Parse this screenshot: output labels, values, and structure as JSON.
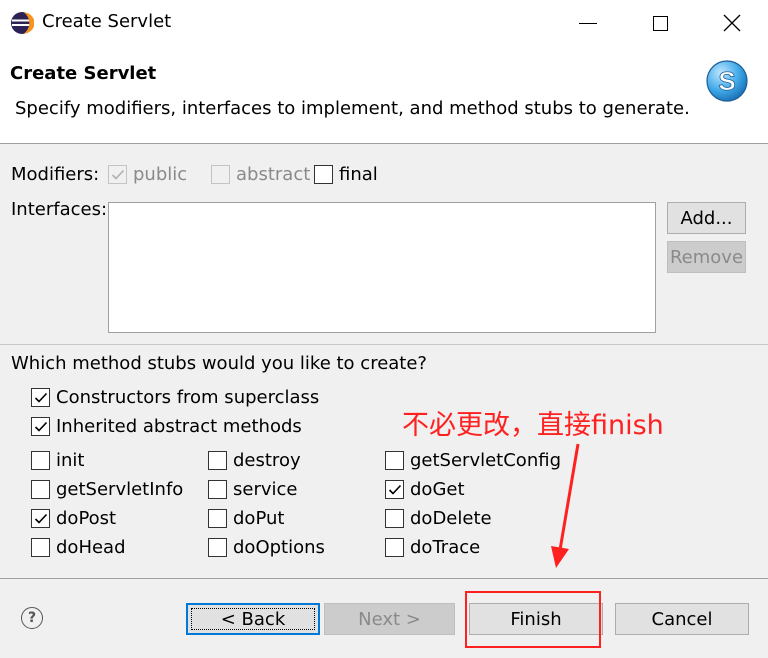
{
  "window": {
    "title": "Create Servlet"
  },
  "header": {
    "title": "Create Servlet",
    "description": "Specify modifiers, interfaces to implement, and method stubs to generate."
  },
  "modifiers": {
    "label": "Modifiers:",
    "public": {
      "label": "public",
      "checked": true,
      "enabled": false
    },
    "abstract": {
      "label": "abstract",
      "checked": false,
      "enabled": false
    },
    "final": {
      "label": "final",
      "checked": false,
      "enabled": true
    }
  },
  "interfaces": {
    "label": "Interfaces:",
    "add_label": "Add...",
    "remove_label": "Remove"
  },
  "stubs": {
    "question": "Which method stubs would you like to create?",
    "constructors": {
      "label": "Constructors from superclass",
      "checked": true
    },
    "inherited": {
      "label": "Inherited abstract methods",
      "checked": true
    },
    "methods": [
      {
        "label": "init",
        "checked": false
      },
      {
        "label": "destroy",
        "checked": false
      },
      {
        "label": "getServletConfig",
        "checked": false
      },
      {
        "label": "getServletInfo",
        "checked": false
      },
      {
        "label": "service",
        "checked": false
      },
      {
        "label": "doGet",
        "checked": true
      },
      {
        "label": "doPost",
        "checked": true
      },
      {
        "label": "doPut",
        "checked": false
      },
      {
        "label": "doDelete",
        "checked": false
      },
      {
        "label": "doHead",
        "checked": false
      },
      {
        "label": "doOptions",
        "checked": false
      },
      {
        "label": "doTrace",
        "checked": false
      }
    ]
  },
  "footer": {
    "help": "?",
    "back_label": "< Back",
    "next_label": "Next >",
    "finish_label": "Finish",
    "cancel_label": "Cancel"
  },
  "annotation": {
    "text": "不必更改，直接finish",
    "color": "#ff2020"
  }
}
